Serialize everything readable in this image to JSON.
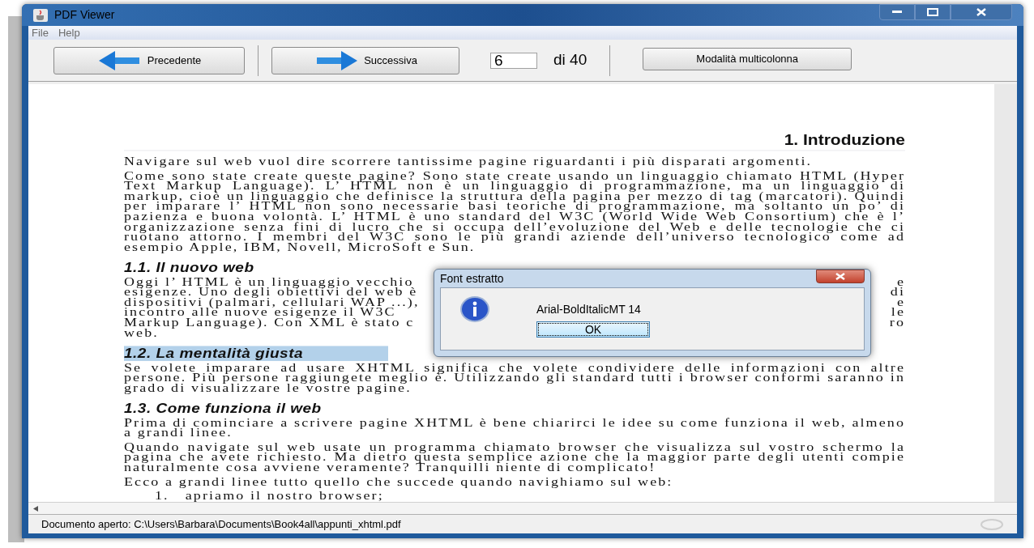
{
  "window": {
    "title": "PDF Viewer"
  },
  "menu": [
    "File",
    "Help"
  ],
  "toolbar": {
    "previous": "Precedente",
    "next": "Successiva",
    "page": "6",
    "of": "di 40",
    "multicolumn": "Modalità multicolonna"
  },
  "document": {
    "blocks": [
      {
        "kind": "heading1",
        "text": "1. Introduzione"
      },
      {
        "kind": "paragraph",
        "text": "Navigare sul web vuol dire scorrere tantissime pagine riguardanti i più disparati argomenti."
      },
      {
        "kind": "paragraph",
        "text": "Come sono state create queste pagine? Sono state create usando un linguaggio chiamato HTML (Hyper Text Markup Language). L’ HTML non è un linguaggio di programmazione, ma un linguaggio di markup, cioè un linguaggio che definisce la struttura della pagina per mezzo di tag (marcatori). Quindi per imparare l’ HTML non sono necessarie basi teoriche di programmazione, ma soltanto un po’ di pazienza e buona volontà. L’ HTML è uno standard del W3C (World Wide Web Consortium) che è l’ organizzazione senza fini di lucro che si occupa dell’evoluzione del Web e delle tecnologie che ci ruotano attorno. I membri del W3C sono le più grandi aziende dell’universo tecnologico come ad esempio Apple, IBM, Novell, MicroSoft e Sun."
      },
      {
        "kind": "heading2",
        "text": "1.1. Il nuovo web",
        "highlighted": false
      },
      {
        "kind": "covered",
        "lines": [
          {
            "left": "Oggi l’ HTML è un linguaggio vecchio",
            "right": "e"
          },
          {
            "left": "esigenze. Uno degli obiettivi del web è",
            "right": "di"
          },
          {
            "left": "dispositivi (palmari, cellulari WAP ...),",
            "right": "e"
          },
          {
            "left": "incontro alle nuove esigenze il W3C",
            "right": "le"
          },
          {
            "left": "Markup Language). Con XML è stato c",
            "right": "ro"
          },
          {
            "left": "web."
          }
        ]
      },
      {
        "kind": "heading2",
        "text": "1.2. La mentalità giusta",
        "highlighted": true
      },
      {
        "kind": "paragraph",
        "text": "Se volete imparare ad usare XHTML significa che volete condividere delle informazioni con altre persone. Più persone raggiungete meglio è. Utilizzando gli standard tutti i browser conformi saranno in grado di visualizzare le vostre pagine."
      },
      {
        "kind": "heading2",
        "text": "1.3. Come funziona il web",
        "highlighted": false
      },
      {
        "kind": "paragraph",
        "text": "Prima di cominciare a scrivere pagine XHTML è bene chiarirci le idee su come funziona il web, almeno a grandi linee."
      },
      {
        "kind": "paragraph",
        "text": "Quando navigate sul web usate un programma chiamato browser che visualizza sul vostro schermo la pagina che avete richiesto. Ma dietro questa semplice azione che la maggior parte degli utenti compie naturalmente cosa avviene veramente? Tranquilli niente di complicato!"
      },
      {
        "kind": "paragraph",
        "text": "Ecco a grandi linee tutto quello che succede quando navighiamo sul web:"
      },
      {
        "kind": "list_item",
        "number": "1.",
        "text": "apriamo il nostro browser;"
      }
    ]
  },
  "dialog": {
    "title": "Font estratto",
    "message": "Arial-BoldItalicMT 14",
    "button": "OK"
  },
  "status_bar": "Documento aperto: C:\\Users\\Barbara\\Documents\\Book4all\\appunti_xhtml.pdf"
}
